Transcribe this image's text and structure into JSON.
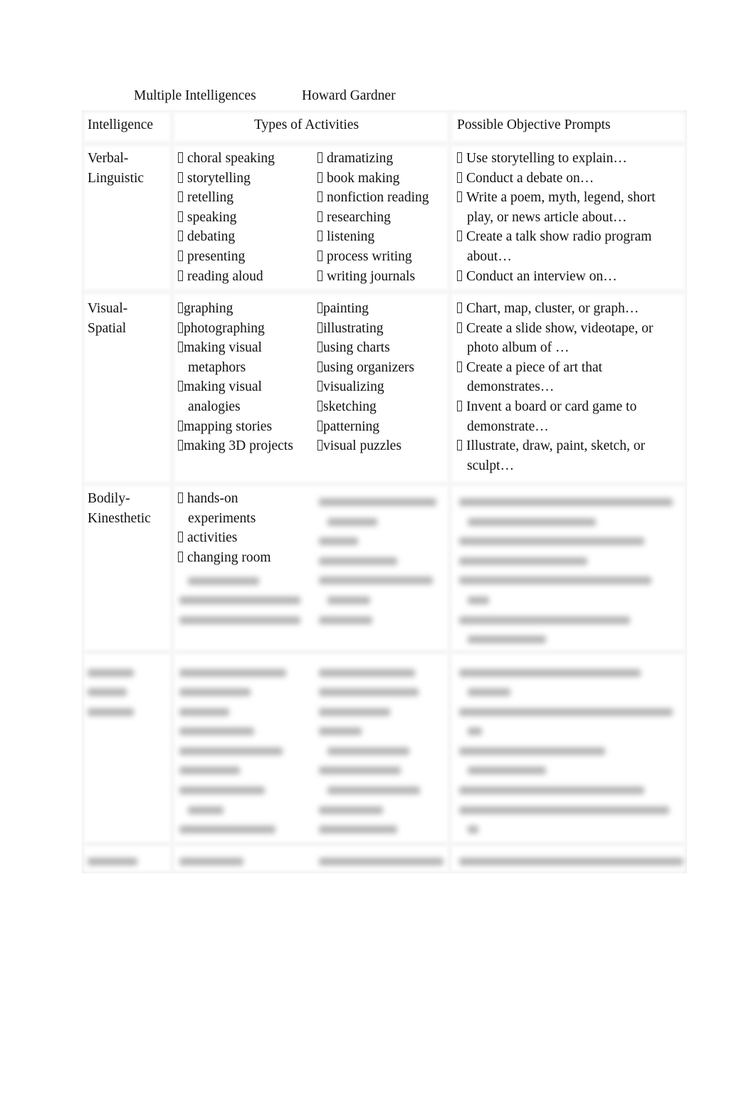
{
  "heading": {
    "title": "Multiple Intelligences",
    "author": "Howard Gardner"
  },
  "columns": [
    "Intelligence",
    "Types of Activities",
    "Possible Objective Prompts"
  ],
  "rows": [
    {
      "intelligence": [
        "Verbal-",
        "Linguistic"
      ],
      "col_a": [
        [
          "choral speaking"
        ],
        [
          "storytelling"
        ],
        [
          "retelling"
        ],
        [
          "speaking"
        ],
        [
          "debating"
        ],
        [
          "presenting"
        ],
        [
          "reading aloud"
        ]
      ],
      "col_b": [
        [
          "dramatizing"
        ],
        [
          "book making"
        ],
        [
          "nonfiction reading"
        ],
        [
          "researching"
        ],
        [
          "listening"
        ],
        [
          "process writing"
        ],
        [
          "writing journals"
        ]
      ],
      "prompts": [
        [
          "Use storytelling to explain…"
        ],
        [
          "Conduct a debate on…"
        ],
        [
          "Write a poem, myth, legend, short",
          "play, or news article about…"
        ],
        [
          "Create a talk show radio program",
          "about…"
        ],
        [
          "Conduct an interview on…"
        ]
      ]
    },
    {
      "intelligence": [
        "Visual-",
        "Spatial"
      ],
      "col_a": [
        [
          "graphing"
        ],
        [
          "photographing"
        ],
        [
          "making visual",
          "metaphors"
        ],
        [
          "making visual",
          "analogies"
        ],
        [
          "mapping stories"
        ],
        [
          "making 3D projects"
        ]
      ],
      "col_b": [
        [
          "painting"
        ],
        [
          "illustrating"
        ],
        [
          "using charts"
        ],
        [
          "using organizers"
        ],
        [
          "visualizing"
        ],
        [
          "sketching"
        ],
        [
          "patterning"
        ],
        [
          "visual puzzles"
        ]
      ],
      "prompts": [
        [
          "Chart, map, cluster, or graph…"
        ],
        [
          "Create a slide show, videotape, or",
          "photo album of …"
        ],
        [
          "Create a piece of art that",
          "demonstrates…"
        ],
        [
          "Invent a board or card game to",
          "demonstrate…"
        ],
        [
          "Illustrate, draw, paint, sketch, or",
          "sculpt…"
        ]
      ]
    },
    {
      "intelligence": [
        "Bodily-",
        "Kinesthetic"
      ],
      "col_a": [
        [
          "hands-on",
          "experiments"
        ],
        [
          "activities"
        ],
        [
          "changing room"
        ]
      ],
      "col_b": [],
      "prompts": []
    }
  ],
  "bullet_icon": "missing-glyph-box"
}
